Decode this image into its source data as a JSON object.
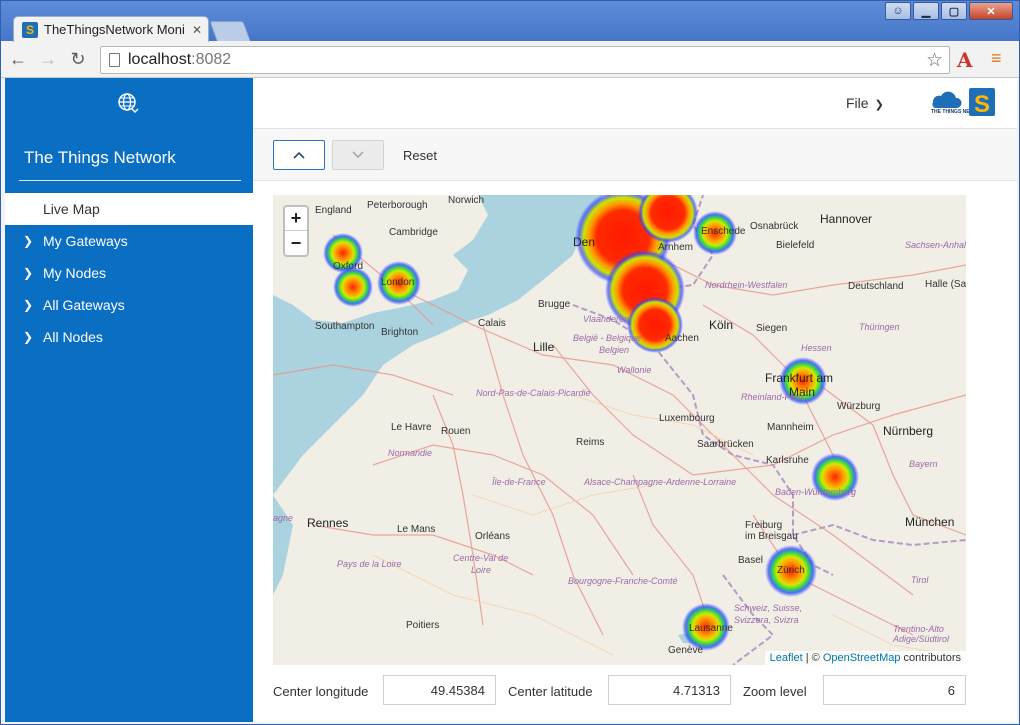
{
  "browser": {
    "tab_title": "TheThingsNetwork Monito",
    "url_host": "localhost",
    "url_port": ":8082"
  },
  "sidebar": {
    "title": "The Things Network",
    "items": [
      {
        "label": "Live Map",
        "active": true
      },
      {
        "label": "My Gateways",
        "active": false
      },
      {
        "label": "My Nodes",
        "active": false
      },
      {
        "label": "All Gateways",
        "active": false
      },
      {
        "label": "All Nodes",
        "active": false
      }
    ]
  },
  "topbar": {
    "file_menu": "File",
    "logo_text": "THE THINGS NETWORK"
  },
  "controls": {
    "reset_label": "Reset"
  },
  "map": {
    "zoom_in": "+",
    "zoom_out": "−",
    "attribution_leaflet": "Leaflet",
    "attribution_sep": " | © ",
    "attribution_osm": "OpenStreetMap",
    "attribution_tail": " contributors",
    "places": {
      "london": "London",
      "oxford": "Oxford",
      "cambridge": "Cambridge",
      "peterborough": "Peterborough",
      "norwich": "Norwich",
      "england": "England",
      "southampton": "Southampton",
      "brighton": "Brighton",
      "calais": "Calais",
      "brugge": "Brugge",
      "lille": "Lille",
      "den": "Den",
      "arnhem": "Arnhem",
      "enschede": "Enschede",
      "osnabruck": "Osnabrück",
      "hannover": "Hannover",
      "bielefeld": "Bielefeld",
      "sachsen": "Sachsen-Anhal",
      "deutschland": "Deutschland",
      "halle": "Halle (Saal",
      "nrw": "Nordrhein-Westfalen",
      "koln": "Köln",
      "siegen": "Siegen",
      "thuringen": "Thüringen",
      "hessen": "Hessen",
      "vlaanderen": "Vlaanderen",
      "belgie": "België - Belgique",
      "aachen": "Aachen",
      "belgien": "Belgien",
      "wallonie": "Wallonie",
      "frankfurt": "Frankfurt am",
      "main": "Main",
      "wurzburg": "Würzburg",
      "rheinland": "Rheinland-Pfalz",
      "npdc": "Nord-Pas-de-Calais-Picardie",
      "luxembourg": "Luxembourg",
      "lehavre": "Le Havre",
      "rouen": "Rouen",
      "reims": "Reims",
      "saarbrucken": "Saarbrücken",
      "mannheim": "Mannheim",
      "nurnberg": "Nürnberg",
      "normandie": "Normandie",
      "karlsruhe": "Karlsruhe",
      "bayern": "Bayern",
      "iledefrance": "Île-de-France",
      "alsace": "Alsace-Champagne-Ardenne-Lorraine",
      "bw": "Baden-Württemberg",
      "bretagne": "agne",
      "rennes": "Rennes",
      "lemans": "Le Mans",
      "orleans": "Orléans",
      "freiburg": "Freiburg",
      "breisgau": "im Breisgau",
      "munchen": "München",
      "paysdelaloire": "Pays de la Loire",
      "centreval": "Centre-Val de",
      "loire": "Loire",
      "basel": "Basel",
      "zurich": "Zürich",
      "bourgogne": "Bourgogne-Franche-Comté",
      "tirol": "Tirol",
      "schweiz": "Schweiz, Suisse,",
      "svizzera": "Svizzera, Svizra",
      "poitiers": "Poitiers",
      "lausanne": "Lausanne",
      "geneve": "Genève",
      "trentino": "Trentino-Alto",
      "adige": "Adige/Südtirol"
    }
  },
  "fields": {
    "lon_label": "Center longitude",
    "lon_value": "49.45384",
    "lat_label": "Center latitude",
    "lat_value": "4.71313",
    "zoom_label": "Zoom level",
    "zoom_value": "6"
  }
}
